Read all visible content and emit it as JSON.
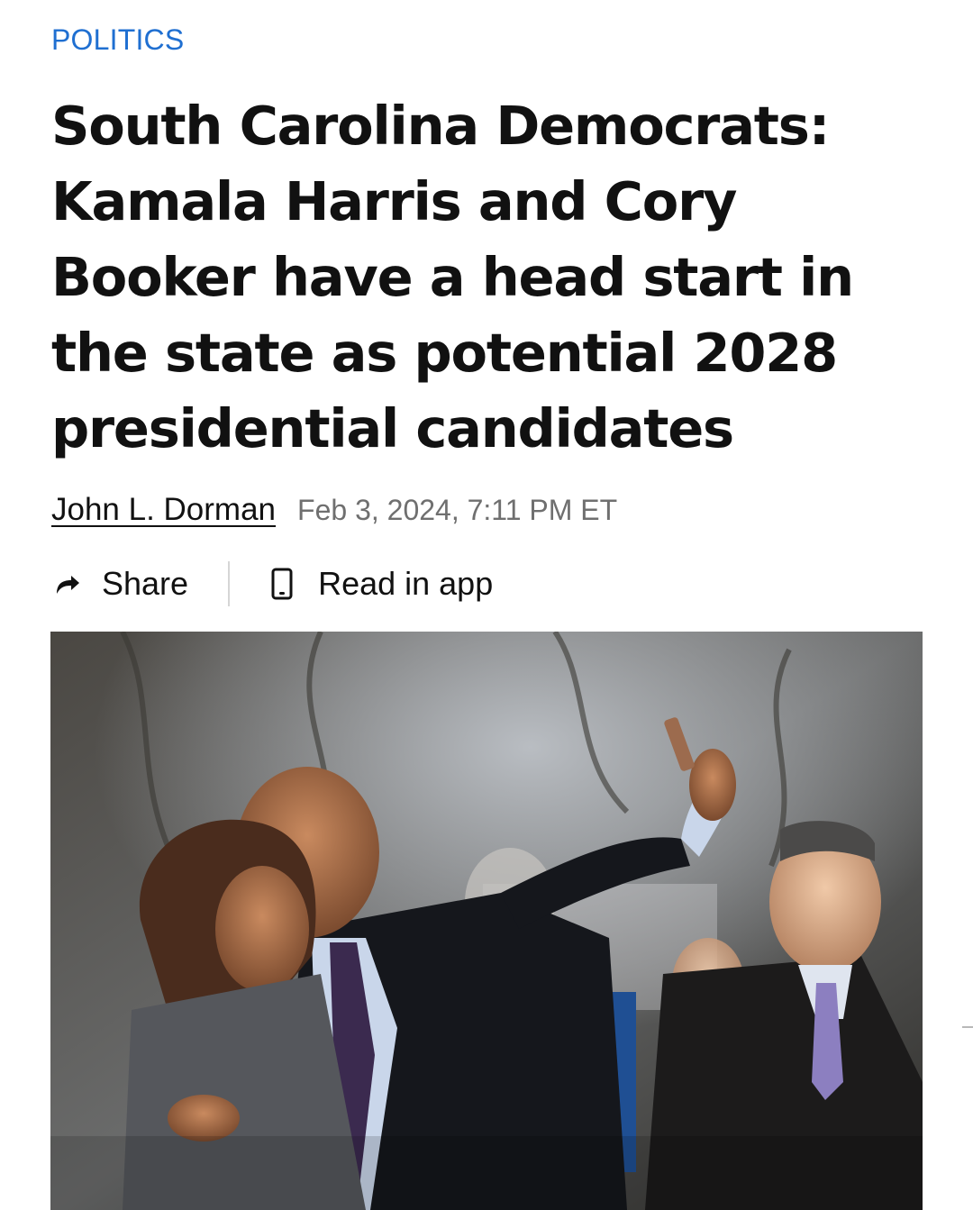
{
  "article": {
    "category": "POLITICS",
    "headline": "South Carolina Democrats: Kamala Harris and Cory Booker have a head start in the state as potential 2028 presidential candidates",
    "author": "John L. Dorman",
    "date": "Feb 3, 2024, 7:11 PM ET"
  },
  "actions": {
    "share_label": "Share",
    "read_in_app_label": "Read in app"
  },
  "icons": {
    "share": "share-arrow-icon",
    "app": "phone-icon"
  },
  "colors": {
    "category": "#1f6fd1",
    "text": "#111111",
    "date": "#6f6f6f",
    "divider": "#d6d6d6"
  }
}
